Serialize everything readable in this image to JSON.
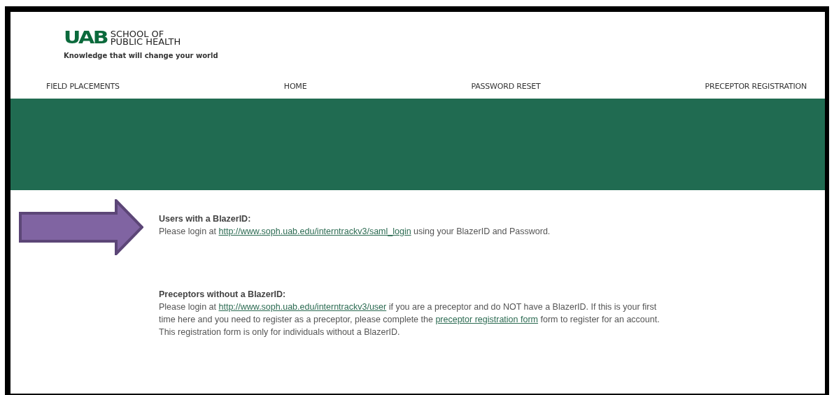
{
  "logo": {
    "mark": "UAB",
    "name_line_1": "SCHOOL OF",
    "name_line_2": "PUBLIC HEALTH",
    "tagline": "Knowledge that will change your world"
  },
  "nav": [
    {
      "label": "FIELD PLACEMENTS"
    },
    {
      "label": "HOME"
    },
    {
      "label": "PASSWORD RESET"
    },
    {
      "label": "PRECEPTOR REGISTRATION"
    }
  ],
  "sections": [
    {
      "heading": "Users with a BlazerID:",
      "arrow": true,
      "body": [
        {
          "kind": "text",
          "text": "Please login at "
        },
        {
          "kind": "link",
          "text": "http://www.soph.uab.edu/interntrackv3/saml_login"
        },
        {
          "kind": "text",
          "text": " using your BlazerID and Password."
        }
      ]
    },
    {
      "heading": "Preceptors without a BlazerID:",
      "body": [
        {
          "kind": "text",
          "text": "Please login at "
        },
        {
          "kind": "link",
          "text": "http://www.soph.uab.edu/interntrackv3/user"
        },
        {
          "kind": "text",
          "text": " if you are a preceptor and do NOT have a BlazerID. If this is your first time here and you need to register as a preceptor, please complete the "
        },
        {
          "kind": "link",
          "text": "preceptor registration form"
        },
        {
          "kind": "text",
          "text": " form to register for an account. This registration form is only for individuals without a BlazerID."
        }
      ]
    }
  ]
}
